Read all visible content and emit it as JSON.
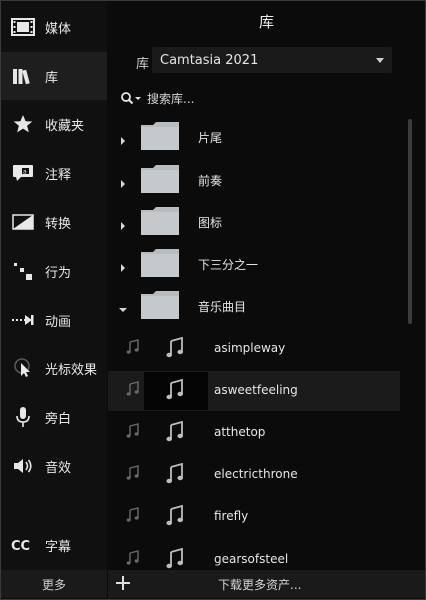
{
  "title": "库",
  "sidebar": {
    "items": [
      {
        "label": "媒体",
        "icon": "film-strip-icon",
        "active": false
      },
      {
        "label": "库",
        "icon": "library-books-icon",
        "active": true
      },
      {
        "label": "收藏夹",
        "icon": "star-icon",
        "active": false
      },
      {
        "label": "注释",
        "icon": "callout-annotation-icon",
        "active": false
      },
      {
        "label": "转换",
        "icon": "transition-icon",
        "active": false
      },
      {
        "label": "行为",
        "icon": "behavior-icon",
        "active": false
      },
      {
        "label": "动画",
        "icon": "animation-arrow-icon",
        "active": false
      },
      {
        "label": "光标效果",
        "icon": "cursor-effect-icon",
        "active": false
      },
      {
        "label": "旁白",
        "icon": "microphone-icon",
        "active": false
      },
      {
        "label": "音效",
        "icon": "speaker-icon",
        "active": false
      },
      {
        "label": "字幕",
        "icon": "closed-caption-icon",
        "active": false
      }
    ],
    "more_label": "更多"
  },
  "library": {
    "label": "库",
    "selected": "Camtasia 2021"
  },
  "search": {
    "placeholder": "搜索库..."
  },
  "folders": [
    {
      "label": "片尾",
      "expanded": false
    },
    {
      "label": "前奏",
      "expanded": false
    },
    {
      "label": "图标",
      "expanded": false
    },
    {
      "label": "下三分之一",
      "expanded": false
    },
    {
      "label": "音乐曲目",
      "expanded": true
    }
  ],
  "tracks": [
    {
      "label": "asimpleway",
      "selected": false
    },
    {
      "label": "asweetfeeling",
      "selected": true
    },
    {
      "label": "atthetop",
      "selected": false
    },
    {
      "label": "electricthrone",
      "selected": false
    },
    {
      "label": "firefly",
      "selected": false
    },
    {
      "label": "gearsofsteel",
      "selected": false
    }
  ],
  "bottom": {
    "download_label": "下载更多资产..."
  },
  "colors": {
    "background": "#0b0b0b",
    "sidebar_active": "#1e1e1e",
    "folder_gray": "#b9bcbf",
    "text": "#e6e6e6"
  }
}
